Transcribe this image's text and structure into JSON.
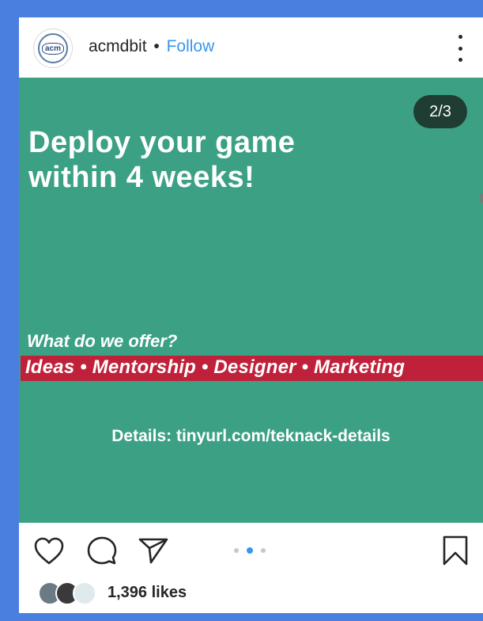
{
  "post": {
    "username": "acmdbit",
    "separator": "•",
    "follow_label": "Follow",
    "avatar_text": "acm",
    "slide_counter": "2/3",
    "headline_line1": "Deploy your game",
    "headline_line2": "within 4 weeks!",
    "offer_question": "What do we offer?",
    "offer_list": "Ideas • Mentorship • Designer • Marketing",
    "details": "Details: tinyurl.com/teknack-details",
    "likes": "1,396 likes",
    "current_slide": 2,
    "total_slides": 3
  },
  "colors": {
    "image_background": "#3ca184",
    "offer_band": "#c0213a",
    "follow": "#3897f0",
    "page_border": "#4a7fe0"
  },
  "icons": {
    "like": "heart-icon",
    "comment": "comment-icon",
    "share": "share-icon",
    "save": "bookmark-icon",
    "more": "more-options-icon"
  }
}
